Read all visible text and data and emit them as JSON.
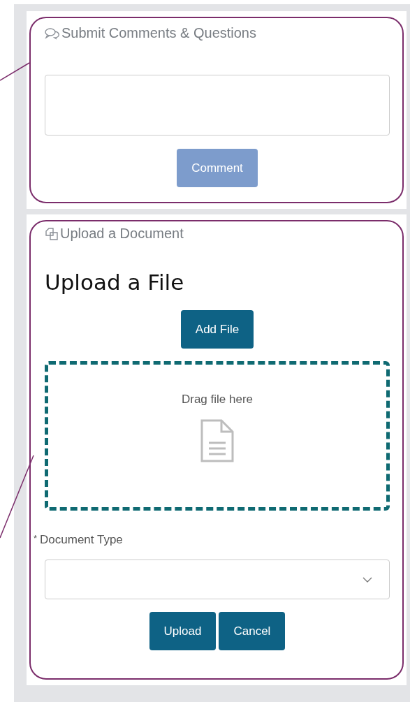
{
  "comments": {
    "title": "Submit Comments & Questions",
    "button": {
      "label": "Comment",
      "disabled": true
    }
  },
  "upload": {
    "title": "Upload a Document",
    "heading": "Upload a File",
    "add_button": "Add File",
    "dropzone": {
      "text": "Drag file here"
    },
    "document_type": {
      "required_mark": "*",
      "label": "Document Type"
    },
    "buttons": [
      "Upload",
      "Cancel"
    ]
  }
}
